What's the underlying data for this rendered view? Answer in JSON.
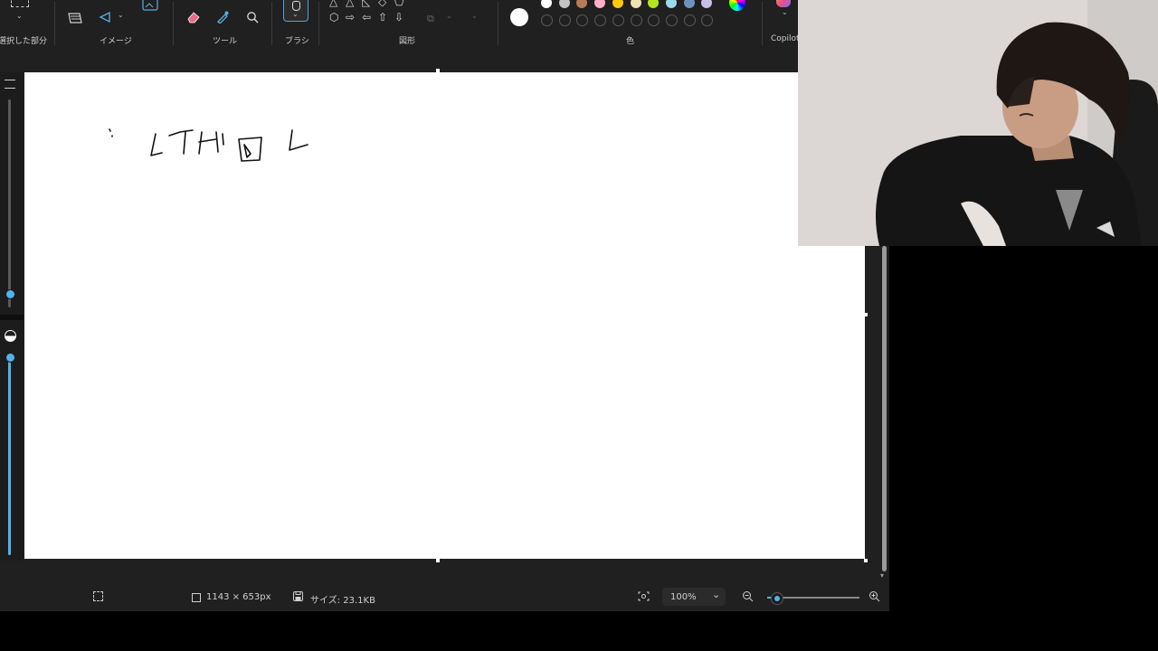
{
  "ribbon": {
    "groups": {
      "selection": "選択した部分",
      "image": "イメージ",
      "tools": "ツール",
      "brush": "ブラシ",
      "shapes": "図形",
      "colors": "色",
      "copilot": "Copilot"
    },
    "icons": {
      "selection": "selection-icon",
      "crop": "crop-icon",
      "rotate": "rotate-icon",
      "image_gen": "image-generate-icon",
      "eraser": "eraser-icon",
      "picker": "color-picker-icon",
      "magnifier": "magnifier-icon",
      "brush": "brush-icon"
    },
    "current_color": "#ffffff",
    "palette_row1": [
      "#ffffff",
      "#c3c3c3",
      "#b97a57",
      "#ffaec9",
      "#ffc90e",
      "#efe4b0",
      "#b5e61d",
      "#99d9ea",
      "#7092be",
      "#c8bfe7"
    ],
    "palette_row2_count": 10
  },
  "status": {
    "dimensions": "1143 × 653px",
    "size": "サイズ: 23.1KB",
    "zoom": "100%",
    "icons": {
      "select_all": "select-all-icon",
      "canvas_size": "canvas-size-icon",
      "save": "save-icon",
      "fit": "fit-to-window-icon",
      "zoom_out": "zoom-out-icon",
      "zoom_in": "zoom-in-icon"
    },
    "zoom_slider_fraction": 0.1
  },
  "left_panel": {
    "size_slider_fraction": 0.4,
    "opacity_slider_fraction": 1.0
  },
  "canvas": {
    "strokes": [
      "hand-drawn-scribble"
    ]
  },
  "webcam": {
    "description_icon": "webcam-feed"
  }
}
